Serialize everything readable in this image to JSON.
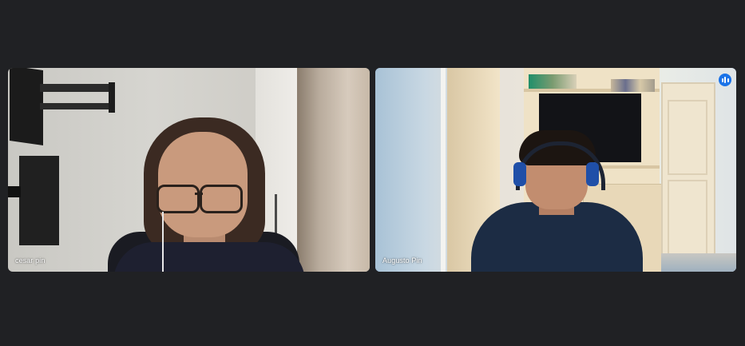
{
  "participants": [
    {
      "name": "cesar pin"
    },
    {
      "name": "Augusto Pin",
      "speaking": true
    }
  ],
  "colors": {
    "background": "#202124",
    "active_speaker_border": "#7aa7e8",
    "speaking_badge": "#1a73e8"
  },
  "icons": {
    "speaking": "audio-level-icon"
  }
}
